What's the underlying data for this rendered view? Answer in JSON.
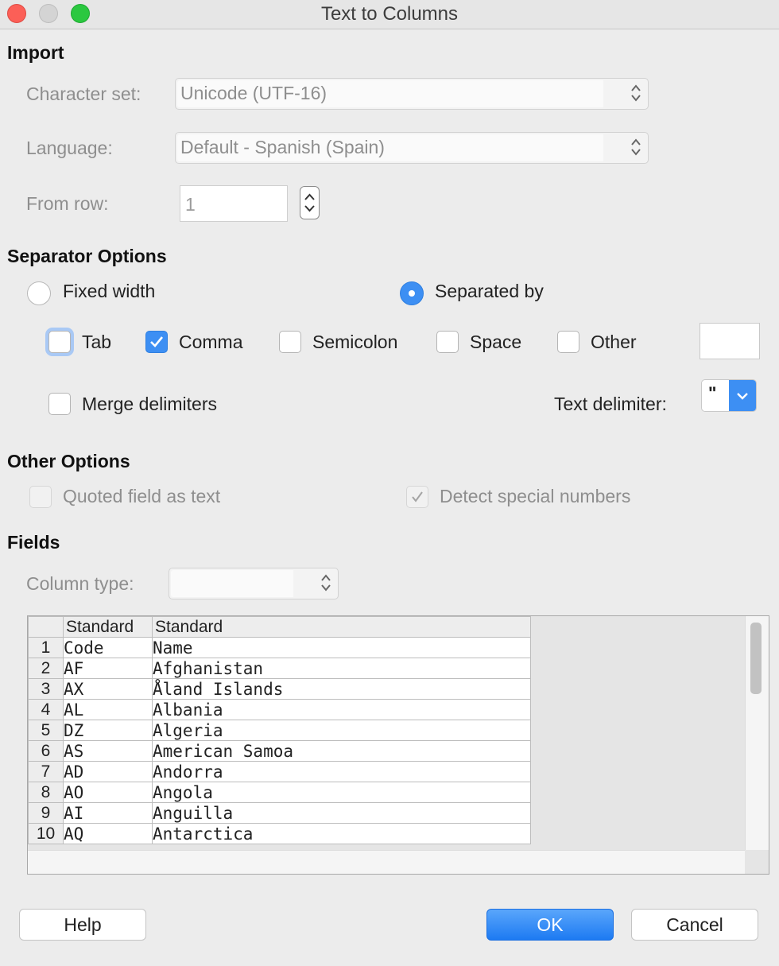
{
  "window": {
    "title": "Text to Columns"
  },
  "import": {
    "heading": "Import",
    "charset_label": "Character set:",
    "charset_value": "Unicode (UTF-16)",
    "language_label": "Language:",
    "language_value": "Default - Spanish (Spain)",
    "from_row_label": "From row:",
    "from_row_value": "1"
  },
  "separator": {
    "heading": "Separator Options",
    "fixed_width": "Fixed width",
    "separated_by": "Separated by",
    "mode": "separated_by",
    "tab": "Tab",
    "comma": "Comma",
    "semicolon": "Semicolon",
    "space": "Space",
    "other": "Other",
    "checked": [
      "Comma"
    ],
    "merge_delimiters": "Merge delimiters",
    "text_delimiter_label": "Text delimiter:",
    "text_delimiter_value": "\""
  },
  "other_options": {
    "heading": "Other Options",
    "quoted_field": "Quoted field as text",
    "detect_special": "Detect special numbers"
  },
  "fields": {
    "heading": "Fields",
    "column_type_label": "Column type:",
    "column_type_value": "",
    "headers": [
      "Standard",
      "Standard"
    ],
    "rows": [
      [
        "1",
        "Code",
        "Name"
      ],
      [
        "2",
        "AF",
        "Afghanistan"
      ],
      [
        "3",
        "AX",
        "Åland Islands"
      ],
      [
        "4",
        "AL",
        "Albania"
      ],
      [
        "5",
        "DZ",
        "Algeria"
      ],
      [
        "6",
        "AS",
        "American Samoa"
      ],
      [
        "7",
        "AD",
        "Andorra"
      ],
      [
        "8",
        "AO",
        "Angola"
      ],
      [
        "9",
        "AI",
        "Anguilla"
      ],
      [
        "10",
        "AQ",
        "Antarctica"
      ]
    ]
  },
  "buttons": {
    "help": "Help",
    "ok": "OK",
    "cancel": "Cancel"
  },
  "colors": {
    "accent": "#3d8ff3",
    "background": "#ececec"
  }
}
